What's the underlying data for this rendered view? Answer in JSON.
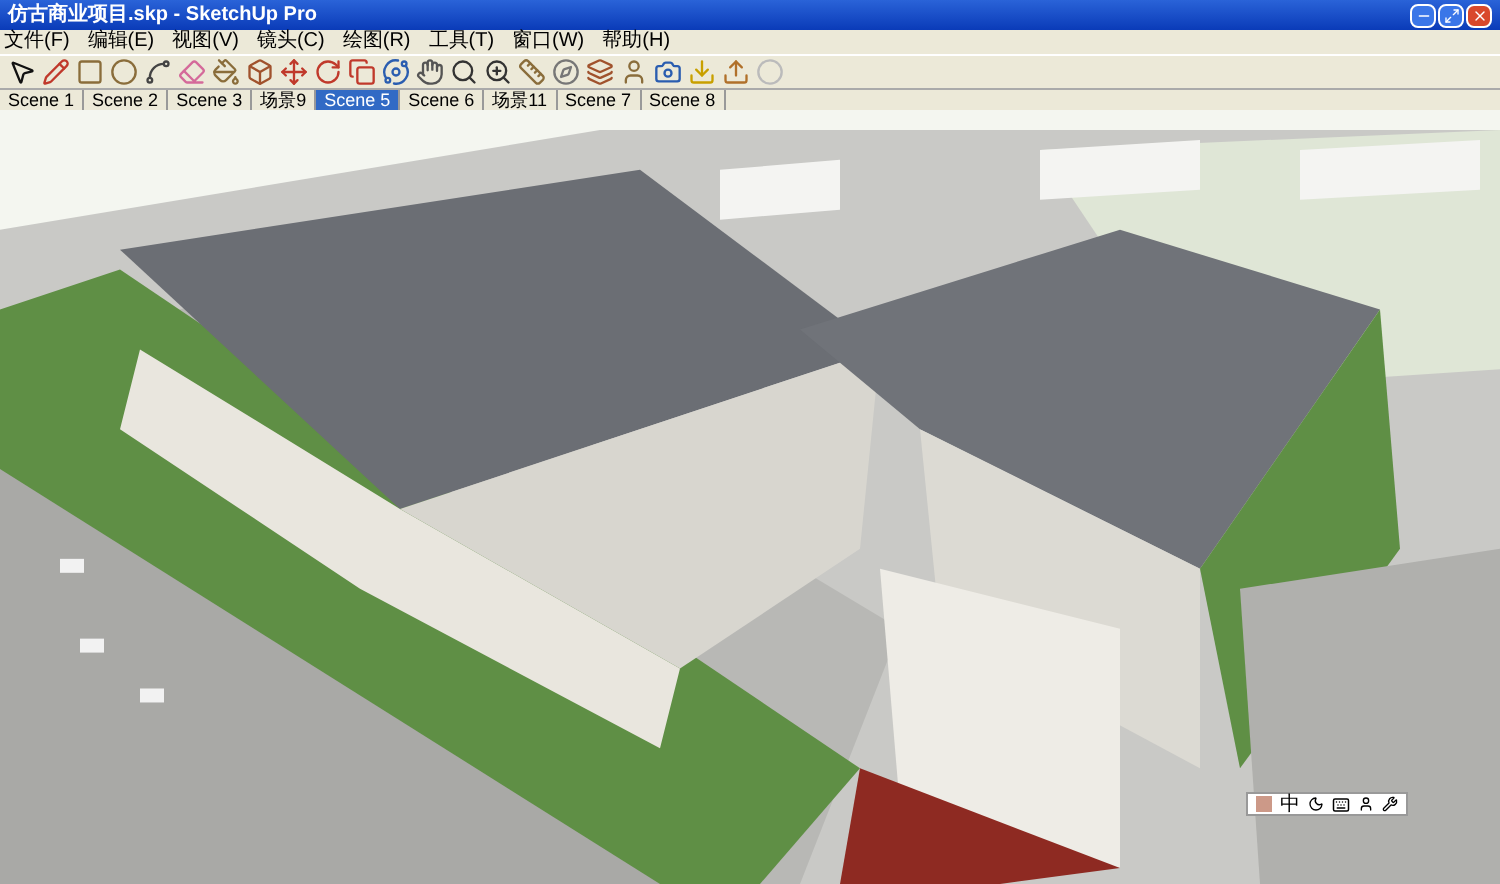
{
  "window": {
    "title": "仿古商业项目.skp - SketchUp Pro"
  },
  "menu": [
    "文件(F)",
    "编辑(E)",
    "视图(V)",
    "镜头(C)",
    "绘图(R)",
    "工具(T)",
    "窗口(W)",
    "帮助(H)"
  ],
  "scenes": [
    {
      "label": "Scene 1",
      "selected": false
    },
    {
      "label": "Scene 2",
      "selected": false
    },
    {
      "label": "Scene 3",
      "selected": false
    },
    {
      "label": "场景9",
      "selected": false
    },
    {
      "label": "Scene 5",
      "selected": true
    },
    {
      "label": "Scene 6",
      "selected": false
    },
    {
      "label": "场景11",
      "selected": false
    },
    {
      "label": "Scene 7",
      "selected": false
    },
    {
      "label": "Scene 8",
      "selected": false
    }
  ],
  "ime_bar": {
    "mode": "中"
  }
}
